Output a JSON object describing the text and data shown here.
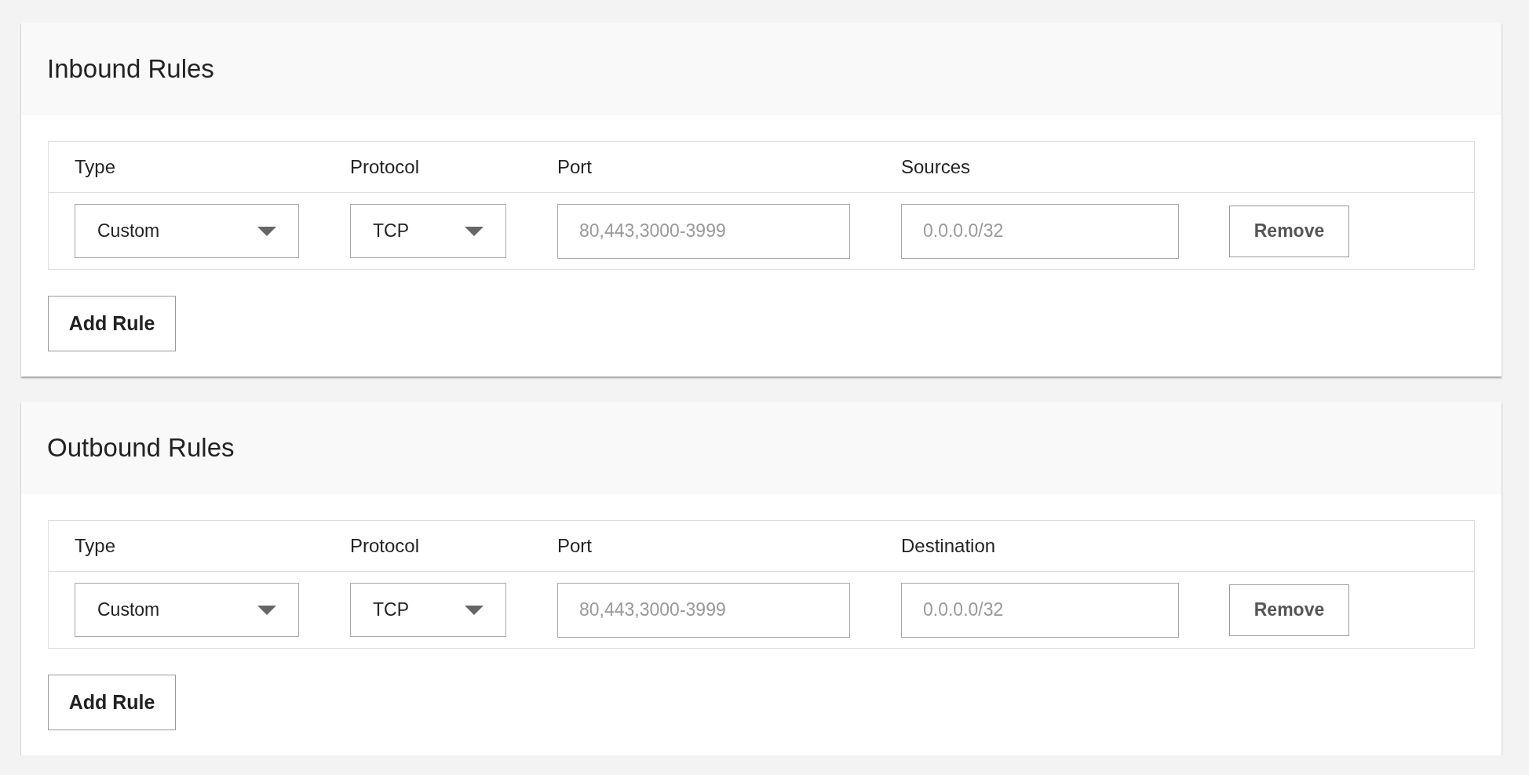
{
  "sections": [
    {
      "title": "Inbound Rules",
      "columns": [
        "Type",
        "Protocol",
        "Port",
        "Sources"
      ],
      "rows": [
        {
          "type": "Custom",
          "protocol": "TCP",
          "port": {
            "placeholder": "80,443,3000-3999"
          },
          "address": {
            "placeholder": "0.0.0.0/32"
          },
          "remove": "Remove"
        }
      ],
      "add_button": "Add Rule"
    },
    {
      "title": "Outbound Rules",
      "columns": [
        "Type",
        "Protocol",
        "Port",
        "Destination"
      ],
      "rows": [
        {
          "type": "Custom",
          "protocol": "TCP",
          "port": {
            "placeholder": "80,443,3000-3999"
          },
          "address": {
            "placeholder": "0.0.0.0/32"
          },
          "remove": "Remove"
        }
      ],
      "add_button": "Add Rule"
    }
  ]
}
